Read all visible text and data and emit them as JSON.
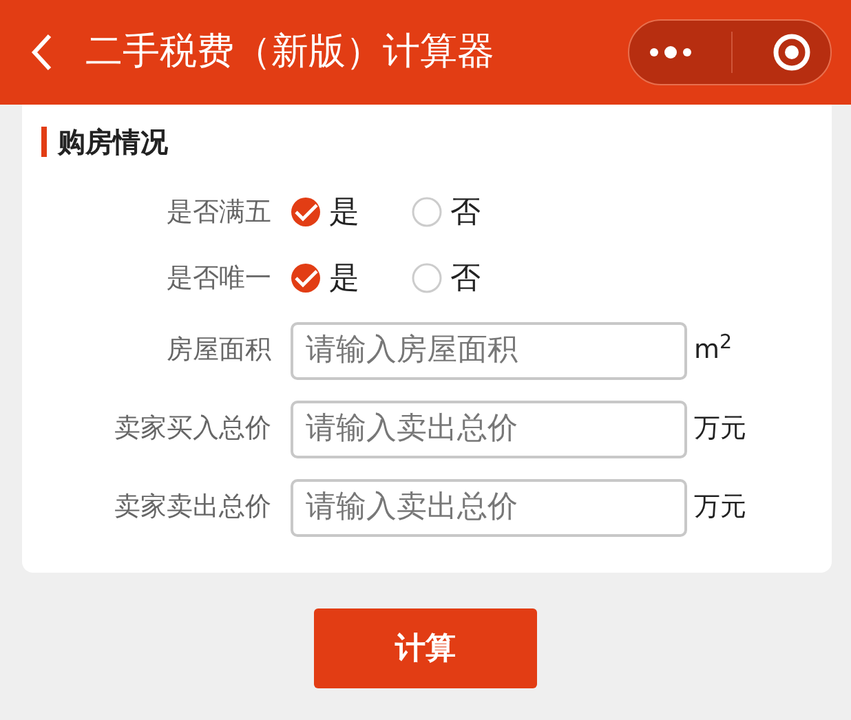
{
  "header": {
    "title": "二手税费（新版）计算器"
  },
  "section": {
    "title": "购房情况"
  },
  "rows": [
    {
      "kind": "radio",
      "label": "是否满五",
      "options": [
        {
          "label": "是",
          "selected": true
        },
        {
          "label": "否",
          "selected": false
        }
      ]
    },
    {
      "kind": "radio",
      "label": "是否唯一",
      "options": [
        {
          "label": "是",
          "selected": true
        },
        {
          "label": "否",
          "selected": false
        }
      ]
    },
    {
      "kind": "input",
      "label": "房屋面积",
      "placeholder": "请输入房屋面积",
      "unit": "m$^{2}$"
    },
    {
      "kind": "input",
      "label": "卖家买入总价",
      "placeholder": "请输入卖出总价",
      "unit": "万元"
    },
    {
      "kind": "input",
      "label": "卖家卖出总价",
      "placeholder": "请输入卖出总价",
      "unit": "万元"
    }
  ],
  "button": "计算"
}
